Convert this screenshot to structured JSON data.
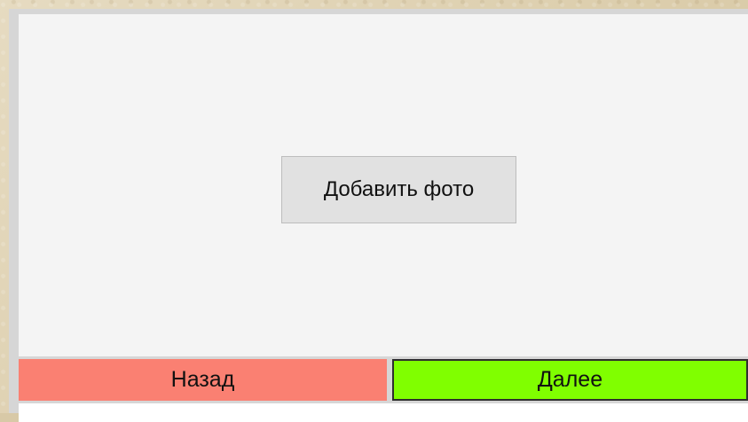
{
  "main": {
    "add_photo_label": "Добавить фото"
  },
  "navigation": {
    "back_label": "Назад",
    "next_label": "Далее"
  },
  "colors": {
    "frame_background": "#d8c9a7",
    "window_background": "#d6d6d6",
    "content_background": "#f4f4f4",
    "button_background": "#e1e1e1",
    "back_button": "#fa8072",
    "next_button": "#80ff00",
    "footer_background": "#ffffff"
  }
}
